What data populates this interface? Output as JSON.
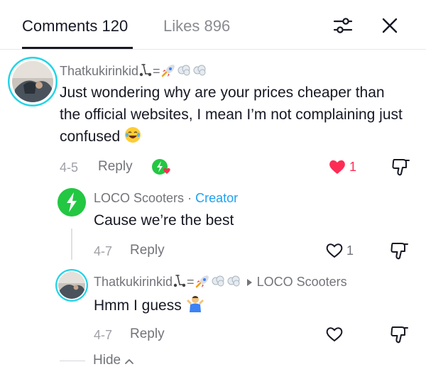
{
  "header": {
    "tabs": [
      {
        "label": "Comments 120"
      },
      {
        "label": "Likes 896"
      }
    ]
  },
  "icons": {
    "filter": "sliders-icon",
    "close": "close-icon",
    "heart": "heart-icon",
    "dislike": "thumbs-down-icon"
  },
  "colors": {
    "accent_red": "#fe2c55",
    "creator_blue": "#1da1f2",
    "brand_green": "#23c742",
    "avatar_ring": "#22d3e6"
  },
  "comments": [
    {
      "username": "Thatkukirinkid",
      "username_suffix": "=",
      "text": "Just wondering why are your prices cheaper than the official websites, I mean I’m not complaining just confused",
      "date": "4-5",
      "reply_label": "Reply",
      "likes": "1",
      "liked": true
    }
  ],
  "replies": [
    {
      "username": "LOCO Scooters",
      "separator": "·",
      "badge": "Creator",
      "text": "Cause we’re the best",
      "date": "4-7",
      "reply_label": "Reply",
      "likes": "1"
    },
    {
      "username": "Thatkukirinkid",
      "username_suffix": "=",
      "reply_to": "LOCO Scooters",
      "text": "Hmm I guess",
      "date": "4-7",
      "reply_label": "Reply",
      "likes": ""
    }
  ],
  "hide_label": "Hide"
}
